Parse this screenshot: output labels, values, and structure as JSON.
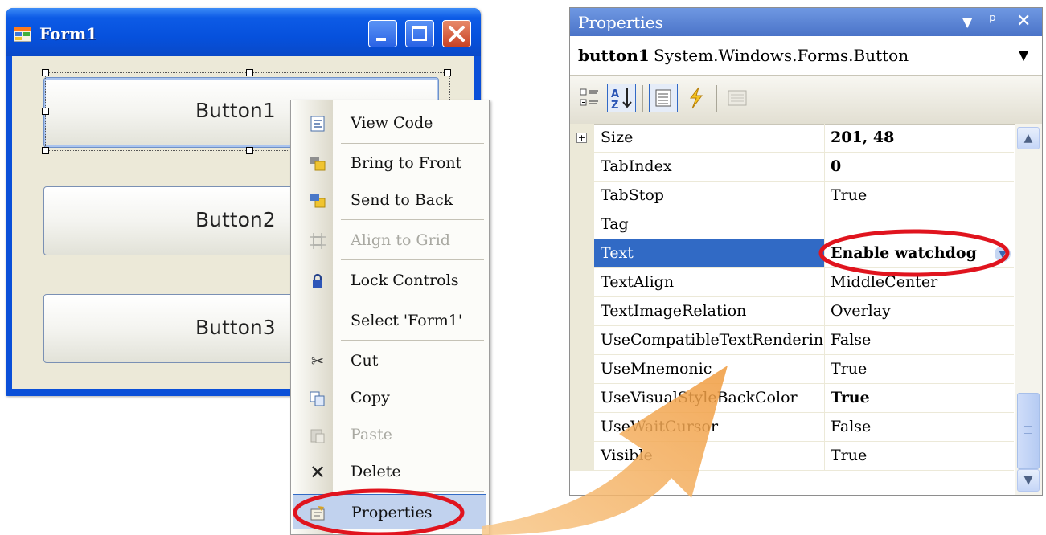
{
  "form": {
    "title": "Form1",
    "buttons": [
      "Button1",
      "Button2",
      "Button3"
    ]
  },
  "context_menu": {
    "items": [
      {
        "label": "View Code",
        "icon": "view-code-icon",
        "enabled": true
      },
      {
        "label": "Bring to Front",
        "icon": "bring-to-front-icon",
        "enabled": true
      },
      {
        "label": "Send to Back",
        "icon": "send-to-back-icon",
        "enabled": true
      },
      {
        "label": "Align to Grid",
        "icon": "align-to-grid-icon",
        "enabled": false
      },
      {
        "label": "Lock Controls",
        "icon": "lock-icon",
        "enabled": true
      },
      {
        "label": "Select 'Form1'",
        "icon": "",
        "enabled": true
      },
      {
        "label": "Cut",
        "icon": "scissors-icon",
        "enabled": true
      },
      {
        "label": "Copy",
        "icon": "copy-icon",
        "enabled": true
      },
      {
        "label": "Paste",
        "icon": "paste-icon",
        "enabled": false
      },
      {
        "label": "Delete",
        "icon": "delete-icon",
        "enabled": true
      },
      {
        "label": "Properties",
        "icon": "properties-icon",
        "enabled": true,
        "highlighted": true
      }
    ]
  },
  "properties_panel": {
    "title": "Properties",
    "object_name": "button1",
    "object_type": "System.Windows.Forms.Button",
    "rows": [
      {
        "name": "Size",
        "value": "201, 48",
        "bold": true,
        "expandable": true
      },
      {
        "name": "TabIndex",
        "value": "0",
        "bold": true
      },
      {
        "name": "TabStop",
        "value": "True"
      },
      {
        "name": "Tag",
        "value": ""
      },
      {
        "name": "Text",
        "value": "Enable watchdog",
        "bold": true,
        "selected": true
      },
      {
        "name": "TextAlign",
        "value": "MiddleCenter"
      },
      {
        "name": "TextImageRelation",
        "value": "Overlay"
      },
      {
        "name": "UseCompatibleTextRendering",
        "value": "False"
      },
      {
        "name": "UseMnemonic",
        "value": "True"
      },
      {
        "name": "UseVisualStyleBackColor",
        "value": "True",
        "bold": true
      },
      {
        "name": "UseWaitCursor",
        "value": "False"
      },
      {
        "name": "Visible",
        "value": "True"
      }
    ]
  },
  "colors": {
    "titlebar_blue": "#0651dd",
    "selection_blue": "#316ac5",
    "highlight_circle": "#e0141e",
    "arrow_orange": "#f5a04a"
  }
}
